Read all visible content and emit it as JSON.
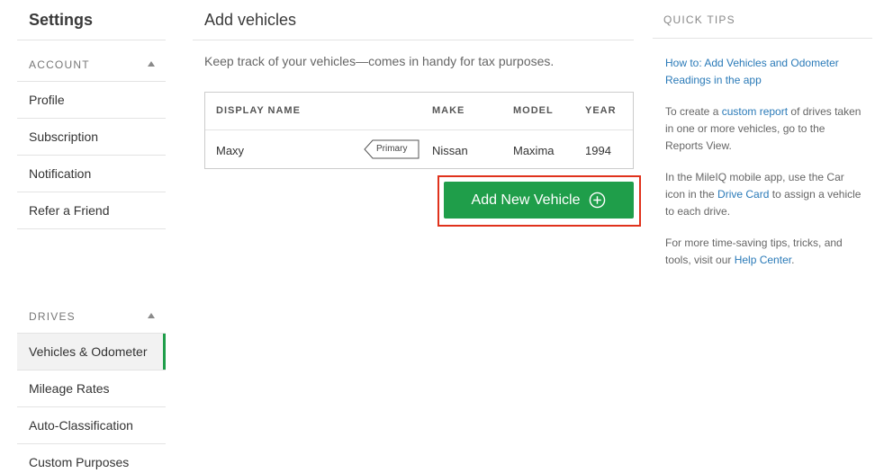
{
  "sidebar": {
    "title": "Settings",
    "account": {
      "header": "ACCOUNT",
      "items": [
        "Profile",
        "Subscription",
        "Notification",
        "Refer a Friend"
      ]
    },
    "drives": {
      "header": "DRIVES",
      "items": [
        "Vehicles & Odometer",
        "Mileage Rates",
        "Auto-Classification",
        "Custom Purposes"
      ],
      "active": "Vehicles & Odometer"
    }
  },
  "main": {
    "title": "Add vehicles",
    "description": "Keep track of your vehicles—comes in handy for tax purposes.",
    "table": {
      "headers": {
        "display_name": "DISPLAY NAME",
        "make": "MAKE",
        "model": "MODEL",
        "year": "YEAR"
      },
      "rows": [
        {
          "display_name": "Maxy",
          "tag": "Primary",
          "make": "Nissan",
          "model": "Maxima",
          "year": "1994"
        }
      ]
    },
    "add_button_label": "Add New Vehicle"
  },
  "tips": {
    "title": "QUICK TIPS",
    "link": "How to: Add Vehicles and Odometer Readings in the app",
    "tip1": {
      "before": "To create a ",
      "link": "custom report",
      "after": " of drives taken in one or more vehicles, go to the Reports View."
    },
    "tip2": {
      "before": "In the MileIQ mobile app, use the Car icon in the ",
      "link": "Drive Card",
      "after": " to assign a vehicle to each drive."
    },
    "tip3": {
      "before": "For more time-saving tips, tricks, and tools, visit our ",
      "link": "Help Center",
      "after": "."
    }
  },
  "colors": {
    "accent_green": "#1f9e4a",
    "link_blue": "#2a7ab8",
    "highlight_red": "#e0321c"
  },
  "icons": {
    "add_button": "plus-circle-icon",
    "section_toggle": "caret-up-icon"
  }
}
